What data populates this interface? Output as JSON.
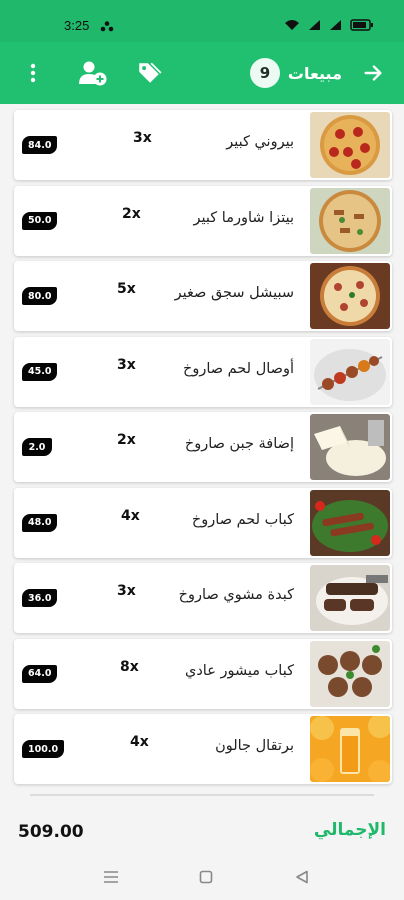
{
  "status": {
    "time": "3:25"
  },
  "header": {
    "title": "مبيعات",
    "count": "9"
  },
  "items": [
    {
      "name": "بيروني كبير",
      "qty": "3x",
      "price": "84.0",
      "image": "pizza-pepperoni"
    },
    {
      "name": "بيتزا شاورما كبير",
      "qty": "2x",
      "price": "50.0",
      "image": "pizza-shawarma"
    },
    {
      "name": "سبيشل سجق صغير",
      "qty": "5x",
      "price": "80.0",
      "image": "pizza-sausage"
    },
    {
      "name": "أوصال لحم صاروخ",
      "qty": "3x",
      "price": "45.0",
      "image": "kebab-skewer"
    },
    {
      "name": "إضافة جبن صاروخ",
      "qty": "2x",
      "price": "2.0",
      "image": "cheese"
    },
    {
      "name": "كباب لحم صاروخ",
      "qty": "4x",
      "price": "48.0",
      "image": "kebab-plate"
    },
    {
      "name": "كبدة مشوي صاروخ",
      "qty": "3x",
      "price": "36.0",
      "image": "grilled-liver"
    },
    {
      "name": "كباب ميشور عادي",
      "qty": "8x",
      "price": "64.0",
      "image": "kebab-meatballs"
    },
    {
      "name": "برتقال جالون",
      "qty": "4x",
      "price": "100.0",
      "image": "orange-juice"
    }
  ],
  "footer": {
    "total_label": "الإجمالي",
    "total_value": "509.00"
  },
  "colors": {
    "primary": "#20c070",
    "status_bar": "#20b86a",
    "badge": "#050505"
  },
  "icons": {
    "back": "arrow-right-icon",
    "tag": "tag-icon",
    "add_person": "add-person-icon",
    "more": "more-vertical-icon"
  }
}
